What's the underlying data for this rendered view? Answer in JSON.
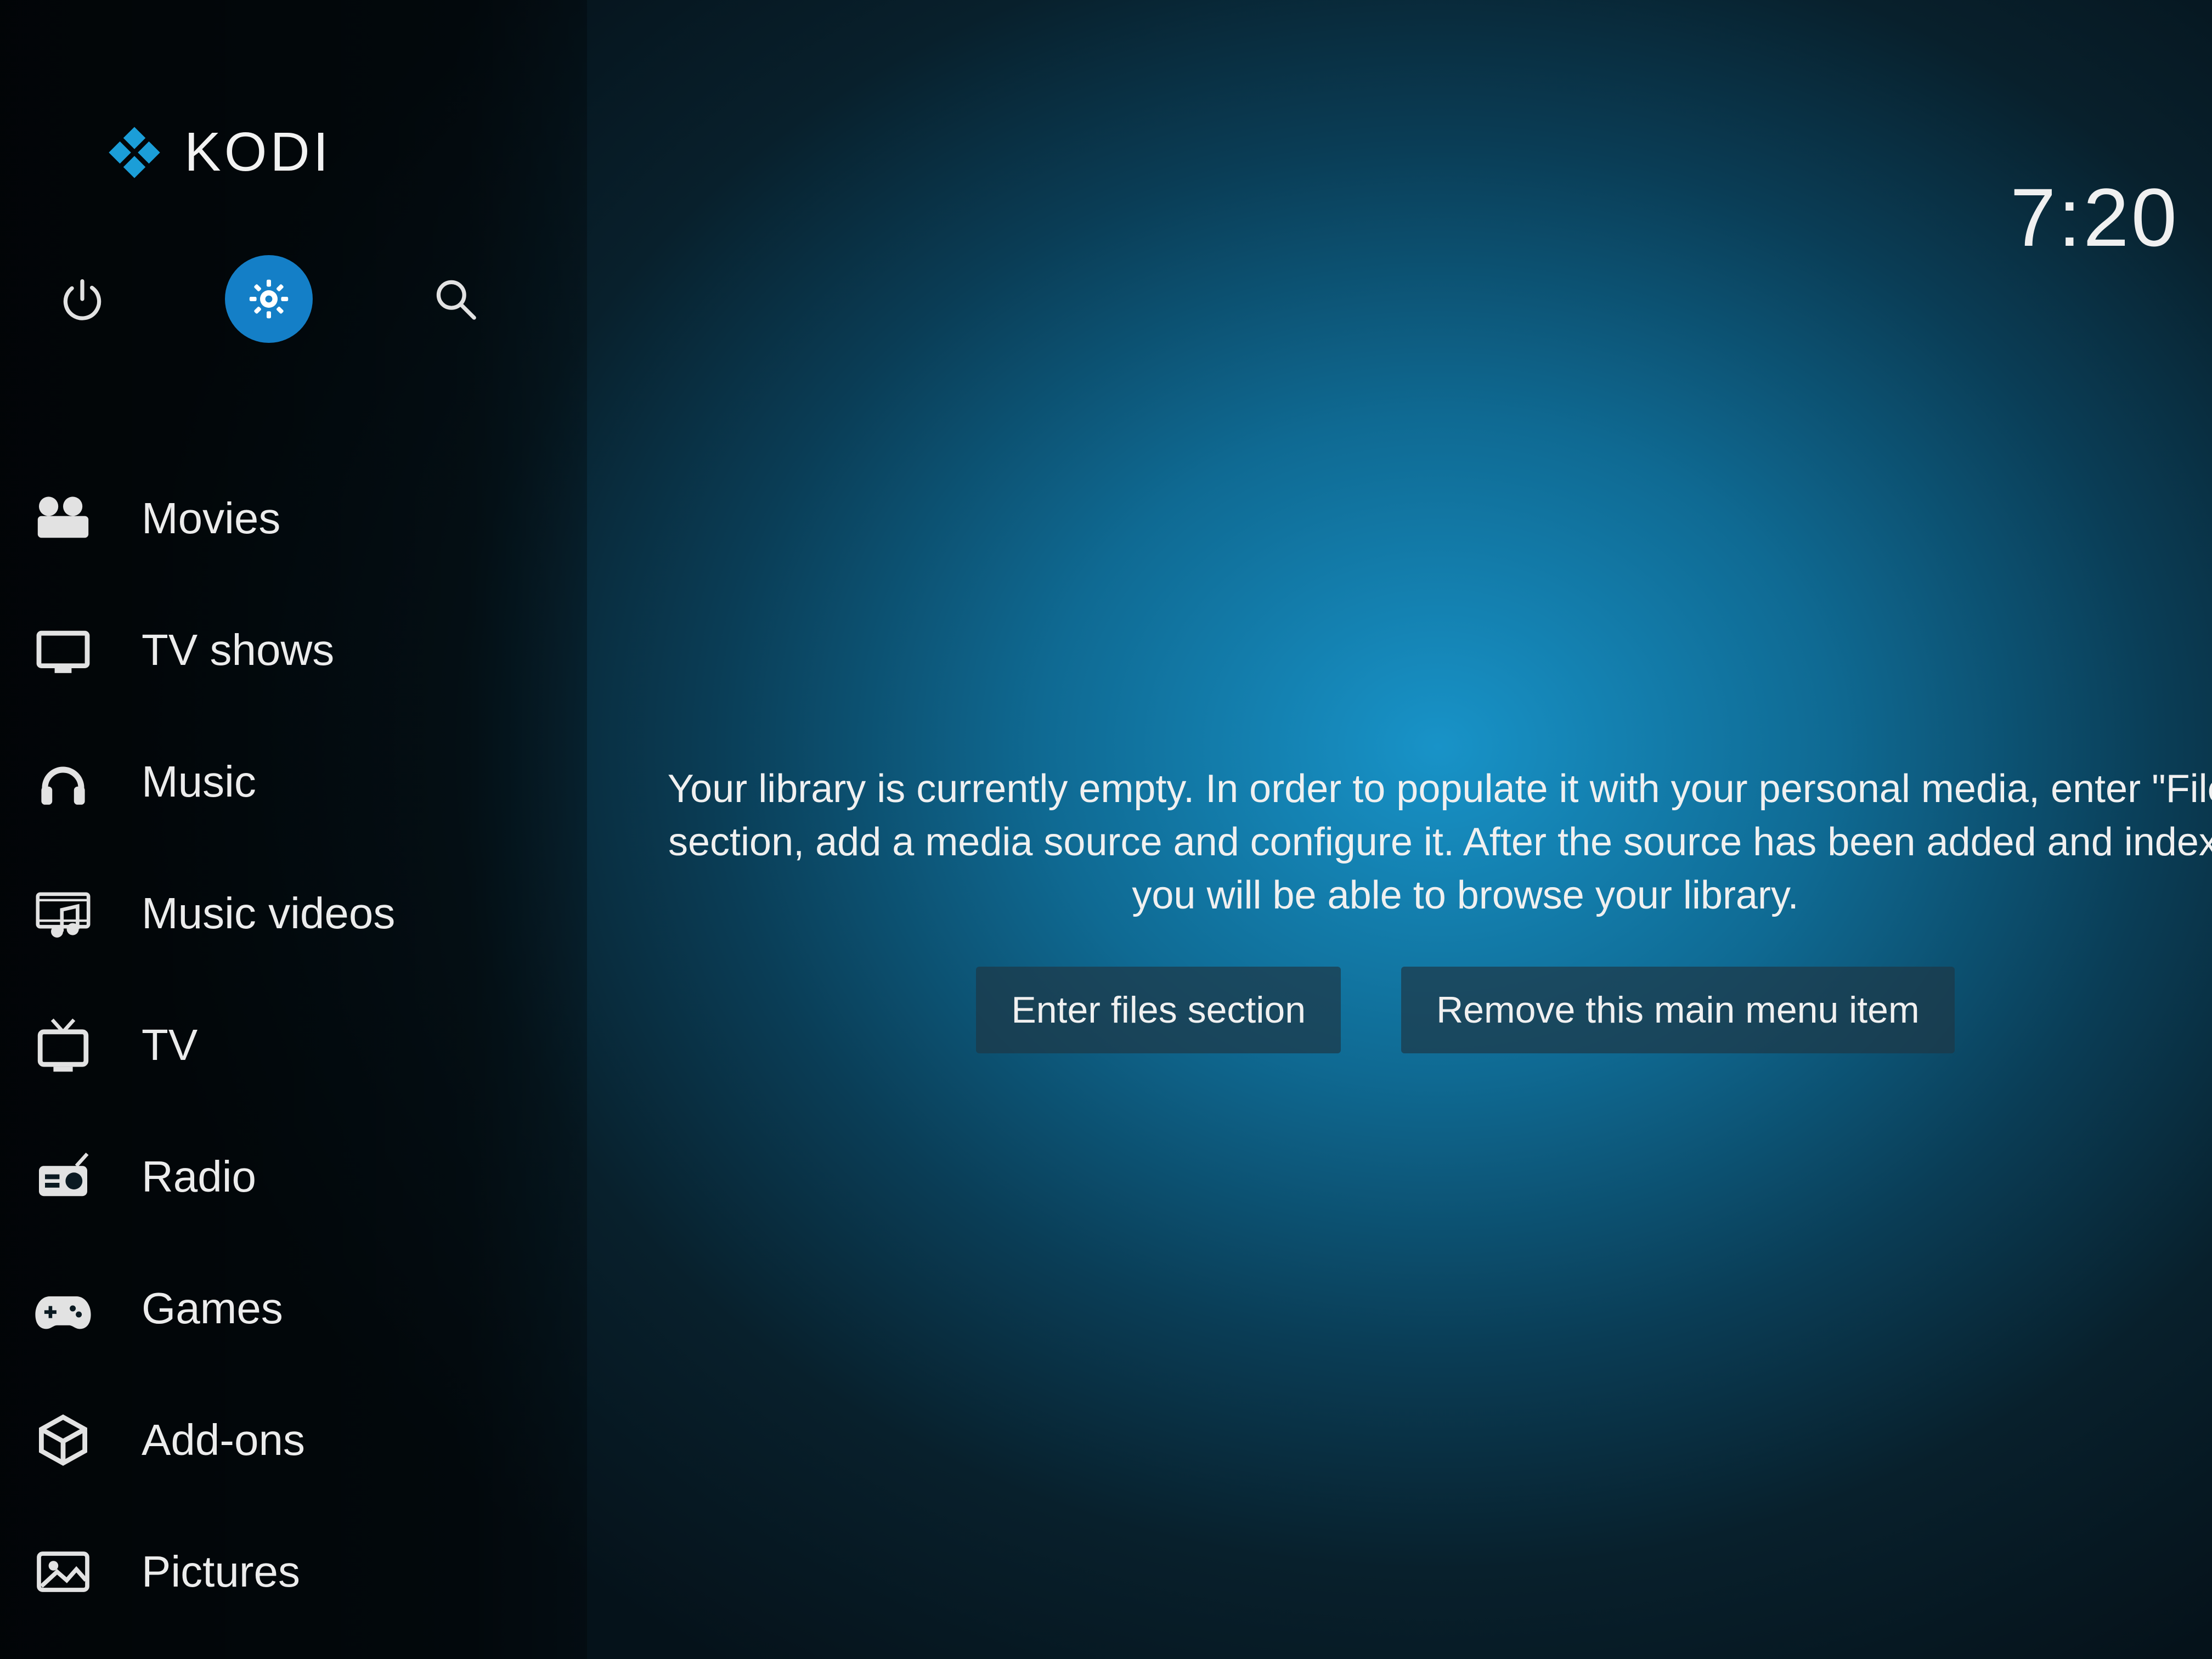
{
  "app": {
    "name": "KODI"
  },
  "header": {
    "clock": "7:20"
  },
  "toolbar": {
    "power": "power",
    "settings": "settings",
    "search": "search",
    "active": "settings"
  },
  "sidebar": {
    "items": [
      {
        "label": "Movies",
        "icon": "movies-icon"
      },
      {
        "label": "TV shows",
        "icon": "tv-shows-icon"
      },
      {
        "label": "Music",
        "icon": "music-icon"
      },
      {
        "label": "Music videos",
        "icon": "music-videos-icon"
      },
      {
        "label": "TV",
        "icon": "tv-icon"
      },
      {
        "label": "Radio",
        "icon": "radio-icon"
      },
      {
        "label": "Games",
        "icon": "games-icon"
      },
      {
        "label": "Add-ons",
        "icon": "addons-icon"
      },
      {
        "label": "Pictures",
        "icon": "pictures-icon"
      }
    ]
  },
  "main": {
    "empty_message": "Your library is currently empty. In order to populate it with your personal media, enter \"Files\" section, add a media source and configure it. After the source has been added and indexed you will be able to browse your library.",
    "buttons": {
      "enter_files": "Enter files section",
      "remove_item": "Remove this main menu item"
    }
  }
}
